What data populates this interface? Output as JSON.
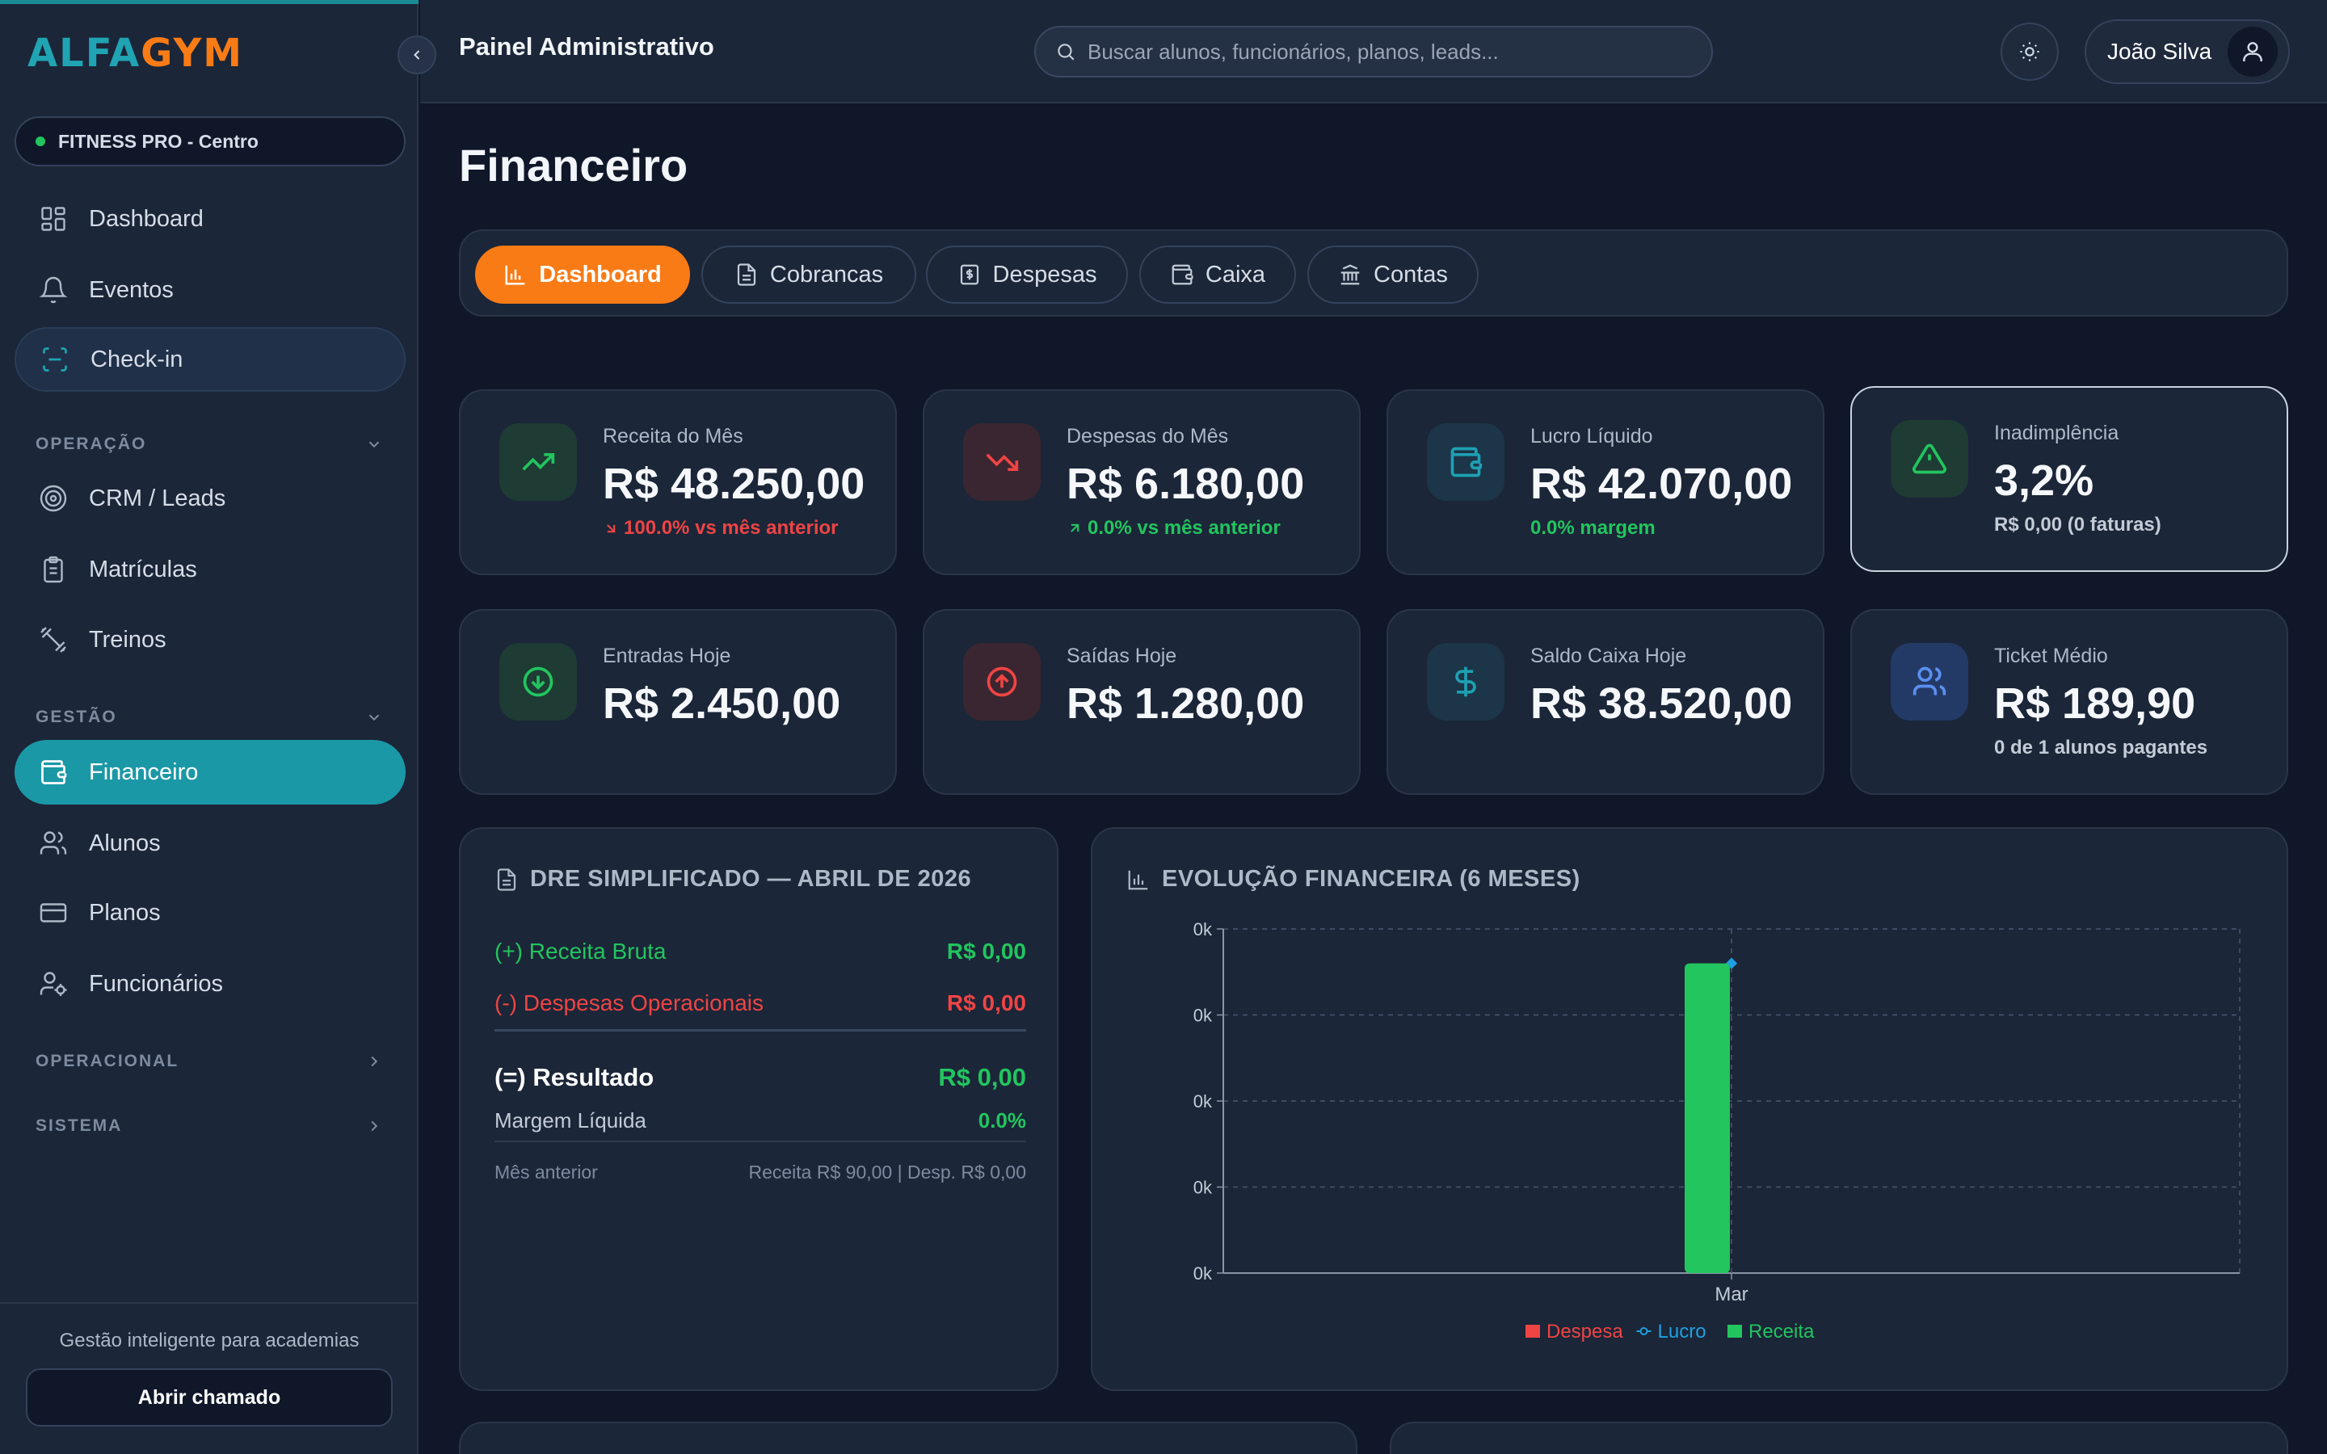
{
  "brand": {
    "part1": "ALFA",
    "part2": "GYM"
  },
  "unit": {
    "label": "FITNESS PRO - Centro"
  },
  "sidebar": {
    "top_items": [
      {
        "label": "Dashboard"
      },
      {
        "label": "Eventos"
      },
      {
        "label": "Check-in"
      }
    ],
    "sections": [
      {
        "label": "OPERAÇÃO",
        "items": [
          {
            "label": "CRM / Leads"
          },
          {
            "label": "Matrículas"
          },
          {
            "label": "Treinos"
          }
        ]
      },
      {
        "label": "GESTÃO",
        "items": [
          {
            "label": "Financeiro"
          },
          {
            "label": "Alunos"
          },
          {
            "label": "Planos"
          },
          {
            "label": "Funcionários"
          }
        ]
      },
      {
        "label": "OPERACIONAL",
        "items": []
      },
      {
        "label": "SISTEMA",
        "items": []
      }
    ],
    "footer_text": "Gestão inteligente para academias",
    "ticket_button": "Abrir chamado"
  },
  "header": {
    "title": "Painel Administrativo",
    "search_placeholder": "Buscar alunos, funcionários, planos, leads...",
    "user_name": "João Silva"
  },
  "page": {
    "title": "Financeiro",
    "tabs": [
      {
        "label": "Dashboard",
        "icon": "bar-chart-icon",
        "active": true
      },
      {
        "label": "Cobrancas",
        "icon": "document-icon",
        "active": false
      },
      {
        "label": "Despesas",
        "icon": "receipt-icon",
        "active": false
      },
      {
        "label": "Caixa",
        "icon": "wallet-icon",
        "active": false
      },
      {
        "label": "Contas",
        "icon": "bank-icon",
        "active": false
      }
    ]
  },
  "kpis": [
    {
      "label": "Receita do Mês",
      "value": "R$ 48.250,00",
      "sub": "100.0% vs mês anterior",
      "sub_color": "#ef4444",
      "icon": "trending-up-icon"
    },
    {
      "label": "Despesas do Mês",
      "value": "R$ 6.180,00",
      "sub": "0.0% vs mês anterior",
      "sub_color": "#22c55e",
      "icon": "trending-down-icon"
    },
    {
      "label": "Lucro Líquido",
      "value": "R$ 42.070,00",
      "sub": "0.0% margem",
      "sub_color": "#22c55e",
      "icon": "wallet-icon"
    },
    {
      "label": "Inadimplência",
      "value": "3,2%",
      "sub": "R$ 0,00 (0 faturas)",
      "sub_color": "#c3cbd7",
      "icon": "alert-triangle-icon"
    },
    {
      "label": "Entradas Hoje",
      "value": "R$ 2.450,00",
      "sub": "",
      "icon": "arrow-down-circle-icon"
    },
    {
      "label": "Saídas Hoje",
      "value": "R$ 1.280,00",
      "sub": "",
      "icon": "arrow-up-circle-icon"
    },
    {
      "label": "Saldo Caixa Hoje",
      "value": "R$ 38.520,00",
      "sub": "",
      "icon": "dollar-icon"
    },
    {
      "label": "Ticket Médio",
      "value": "R$ 189,90",
      "sub": "0 de 1 alunos pagantes",
      "sub_color": "#c3cbd7",
      "icon": "users-icon"
    }
  ],
  "dre": {
    "title": "DRE SIMPLIFICADO — ABRIL DE 2026",
    "receita_label": "(+) Receita Bruta",
    "receita_value": "R$ 0,00",
    "despesas_label": "(-) Despesas Operacionais",
    "despesas_value": "R$ 0,00",
    "resultado_label": "(=) Resultado",
    "resultado_value": "R$ 0,00",
    "margem_label": "Margem Líquida",
    "margem_value": "0.0%",
    "anterior_label": "Mês anterior",
    "anterior_value": "Receita R$ 90,00 | Desp. R$ 0,00"
  },
  "colors": {
    "accent": "#1b98a6",
    "orange": "#f97b16",
    "green": "#22c55e",
    "red": "#ef4444",
    "blue": "#1ea0e0"
  },
  "chart_data": {
    "type": "bar",
    "title": "EVOLUÇÃO FINANCEIRA (6 MESES)",
    "categories": [
      "Mar"
    ],
    "y_tick_labels": [
      "0k",
      "0k",
      "0k",
      "0k",
      "0k"
    ],
    "ylim": [
      0,
      100
    ],
    "grid": true,
    "legend_position": "bottom",
    "series": [
      {
        "name": "Despesa",
        "kind": "bar",
        "color": "#ef4444",
        "values": [
          0
        ]
      },
      {
        "name": "Lucro",
        "kind": "line",
        "color": "#1ea0e0",
        "values": [
          90
        ]
      },
      {
        "name": "Receita",
        "kind": "bar",
        "color": "#22c55e",
        "values": [
          90
        ]
      }
    ]
  }
}
